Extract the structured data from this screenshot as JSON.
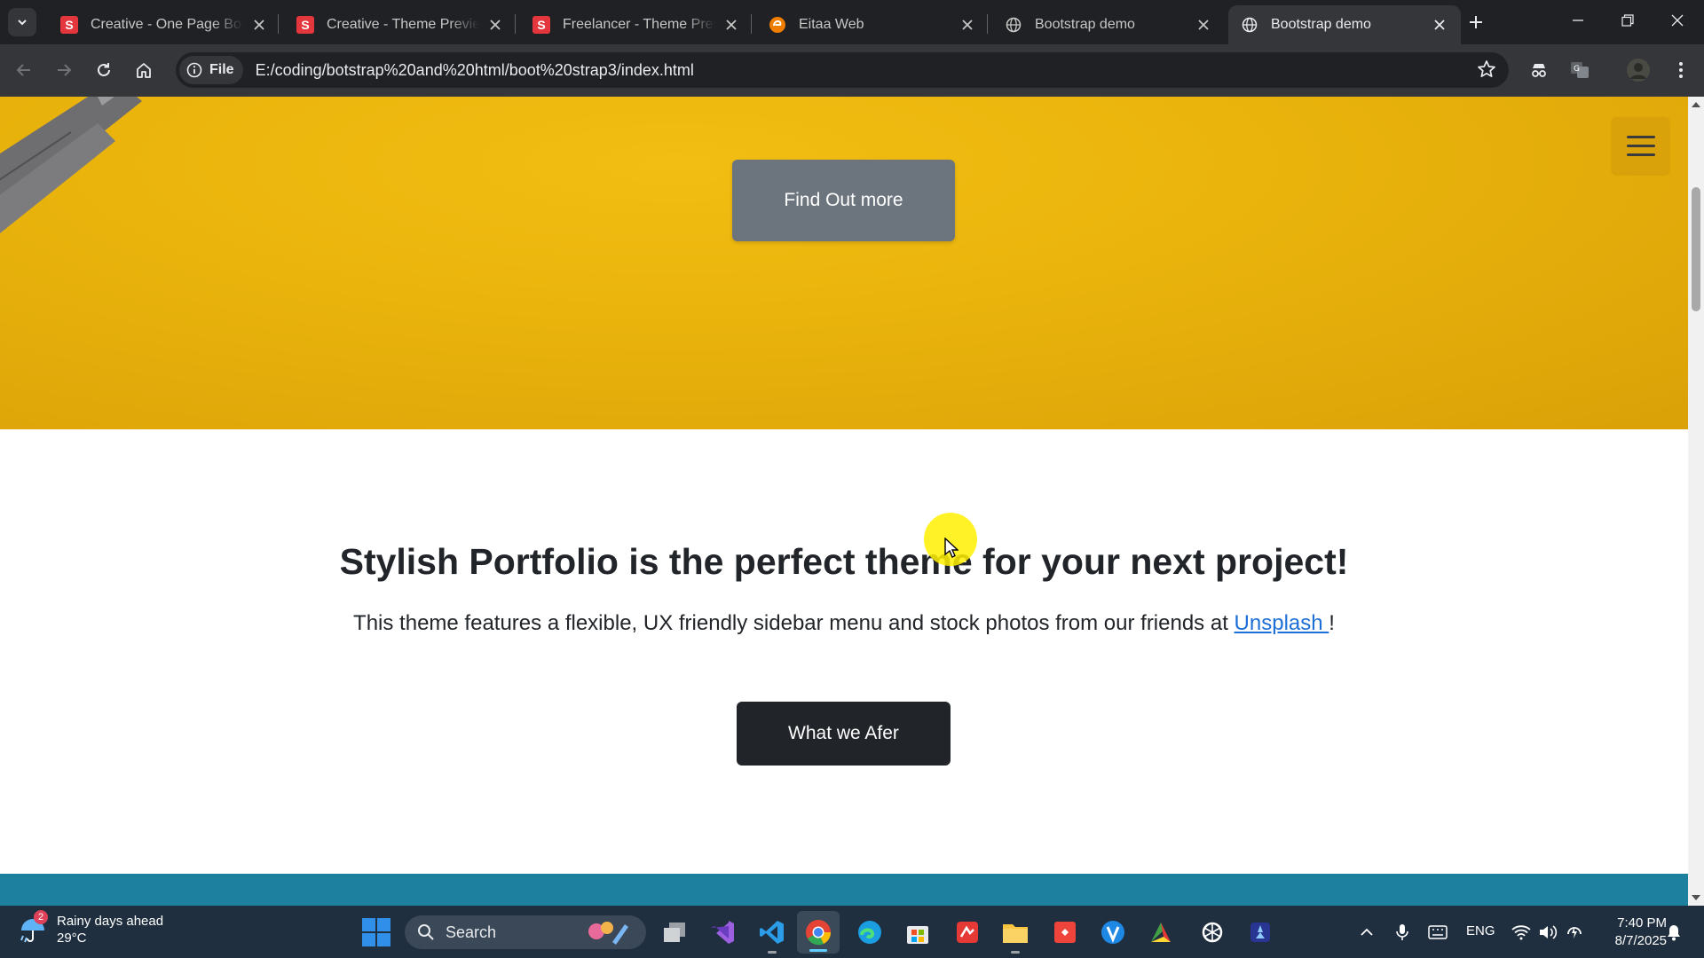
{
  "browser": {
    "tabs": [
      {
        "title": "Creative - One Page Bootstrap",
        "favicon": "s-logo-icon",
        "active": false
      },
      {
        "title": "Creative - Theme Preview - Start Bootstrap",
        "favicon": "s-logo-icon",
        "active": false
      },
      {
        "title": "Freelancer - Theme Preview - Start Bootstrap",
        "favicon": "s-logo-icon",
        "active": false
      },
      {
        "title": "Eitaa Web",
        "favicon": "eitaa-icon",
        "active": false
      },
      {
        "title": "Bootstrap demo",
        "favicon": "globe-icon",
        "active": false
      },
      {
        "title": "Bootstrap demo",
        "favicon": "globe-icon",
        "active": true
      }
    ],
    "site_info_label": "File",
    "url": "E:/coding/botstrap%20and%20html/boot%20strap3/index.html"
  },
  "page": {
    "hero_button": "Find Out more",
    "about_title": "Stylish Portfolio is the perfect theme for your next project!",
    "about_lead_text": "This theme features a flexible, UX friendly sidebar menu and stock photos from our friends at",
    "about_lead_link": "Unsplash ",
    "about_lead_end": "!",
    "about_button": "What we Afer",
    "colors": {
      "hero": "#eab40c",
      "primary_button": "#6c757d",
      "dark_button": "#212529",
      "link": "#1d6fd7",
      "services_band": "#1d809f"
    }
  },
  "taskbar": {
    "weather_badge": "2",
    "weather_title": "Rainy days ahead",
    "weather_temp": "29°C",
    "search_placeholder": "Search",
    "language": "ENG",
    "time": "7:40 PM",
    "date": "8/7/2025"
  }
}
